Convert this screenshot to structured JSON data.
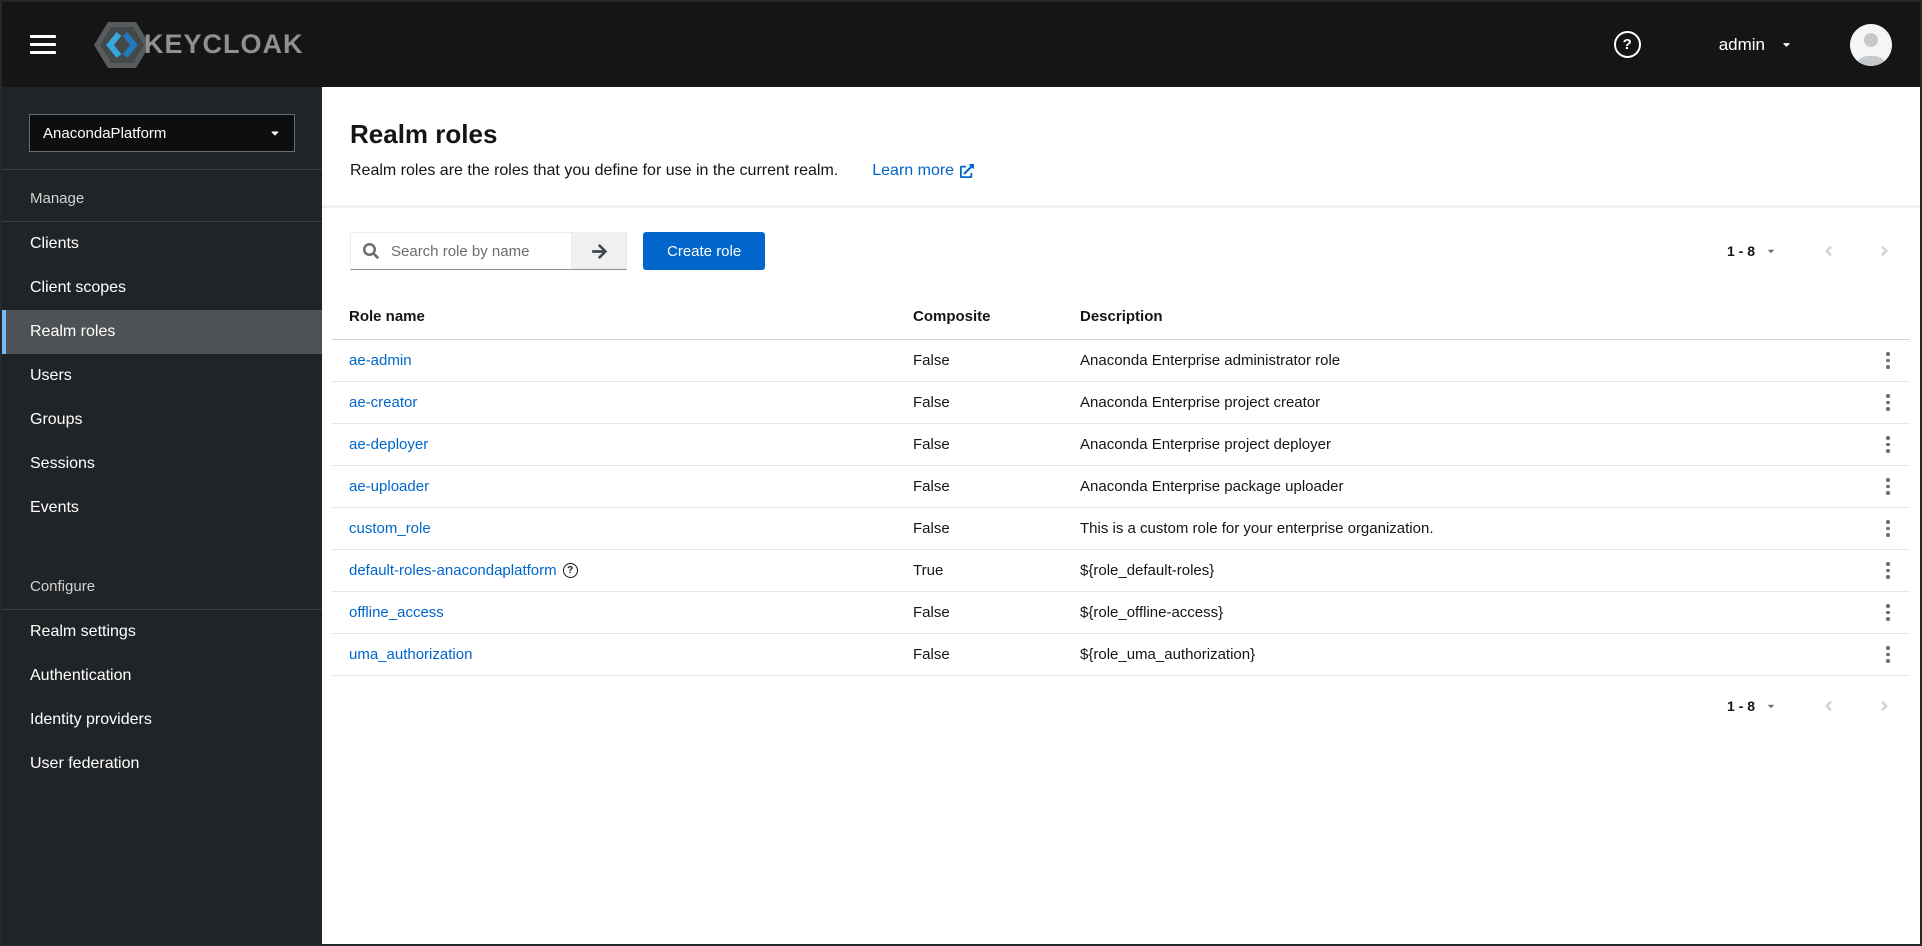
{
  "masthead": {
    "brand": "KEYCLOAK",
    "user_label": "admin"
  },
  "sidebar": {
    "realm_selector": "AnacondaPlatform",
    "sections": [
      {
        "label": "Manage",
        "items": [
          {
            "label": "Clients",
            "active": false
          },
          {
            "label": "Client scopes",
            "active": false
          },
          {
            "label": "Realm roles",
            "active": true
          },
          {
            "label": "Users",
            "active": false
          },
          {
            "label": "Groups",
            "active": false
          },
          {
            "label": "Sessions",
            "active": false
          },
          {
            "label": "Events",
            "active": false
          }
        ]
      },
      {
        "label": "Configure",
        "items": [
          {
            "label": "Realm settings",
            "active": false
          },
          {
            "label": "Authentication",
            "active": false
          },
          {
            "label": "Identity providers",
            "active": false
          },
          {
            "label": "User federation",
            "active": false
          }
        ]
      }
    ]
  },
  "page": {
    "title": "Realm roles",
    "description": "Realm roles are the roles that you define for use in the current realm.",
    "learn_more_label": "Learn more"
  },
  "toolbar": {
    "search_placeholder": "Search role by name",
    "create_button_label": "Create role",
    "pagination_range": "1 - 8"
  },
  "table": {
    "columns": [
      "Role name",
      "Composite",
      "Description"
    ],
    "rows": [
      {
        "name": "ae-admin",
        "composite": "False",
        "description": "Anaconda Enterprise administrator role",
        "help": false
      },
      {
        "name": "ae-creator",
        "composite": "False",
        "description": "Anaconda Enterprise project creator",
        "help": false
      },
      {
        "name": "ae-deployer",
        "composite": "False",
        "description": "Anaconda Enterprise project deployer",
        "help": false
      },
      {
        "name": "ae-uploader",
        "composite": "False",
        "description": "Anaconda Enterprise package uploader",
        "help": false
      },
      {
        "name": "custom_role",
        "composite": "False",
        "description": "This is a custom role for your enterprise organization.",
        "help": false
      },
      {
        "name": "default-roles-anacondaplatform",
        "composite": "True",
        "description": "${role_default-roles}",
        "help": true
      },
      {
        "name": "offline_access",
        "composite": "False",
        "description": "${role_offline-access}",
        "help": false
      },
      {
        "name": "uma_authorization",
        "composite": "False",
        "description": "${role_uma_authorization}",
        "help": false
      }
    ]
  },
  "icons": {
    "question_mark_glyph": "?"
  },
  "colors": {
    "accent_blue": "#0066cc",
    "nav_active_accent": "#73bcf7",
    "nav_active_bg": "#4f5255",
    "masthead_bg": "#151515",
    "sidebar_bg": "#212427",
    "disabled_chevron": "#d2d2d2"
  }
}
